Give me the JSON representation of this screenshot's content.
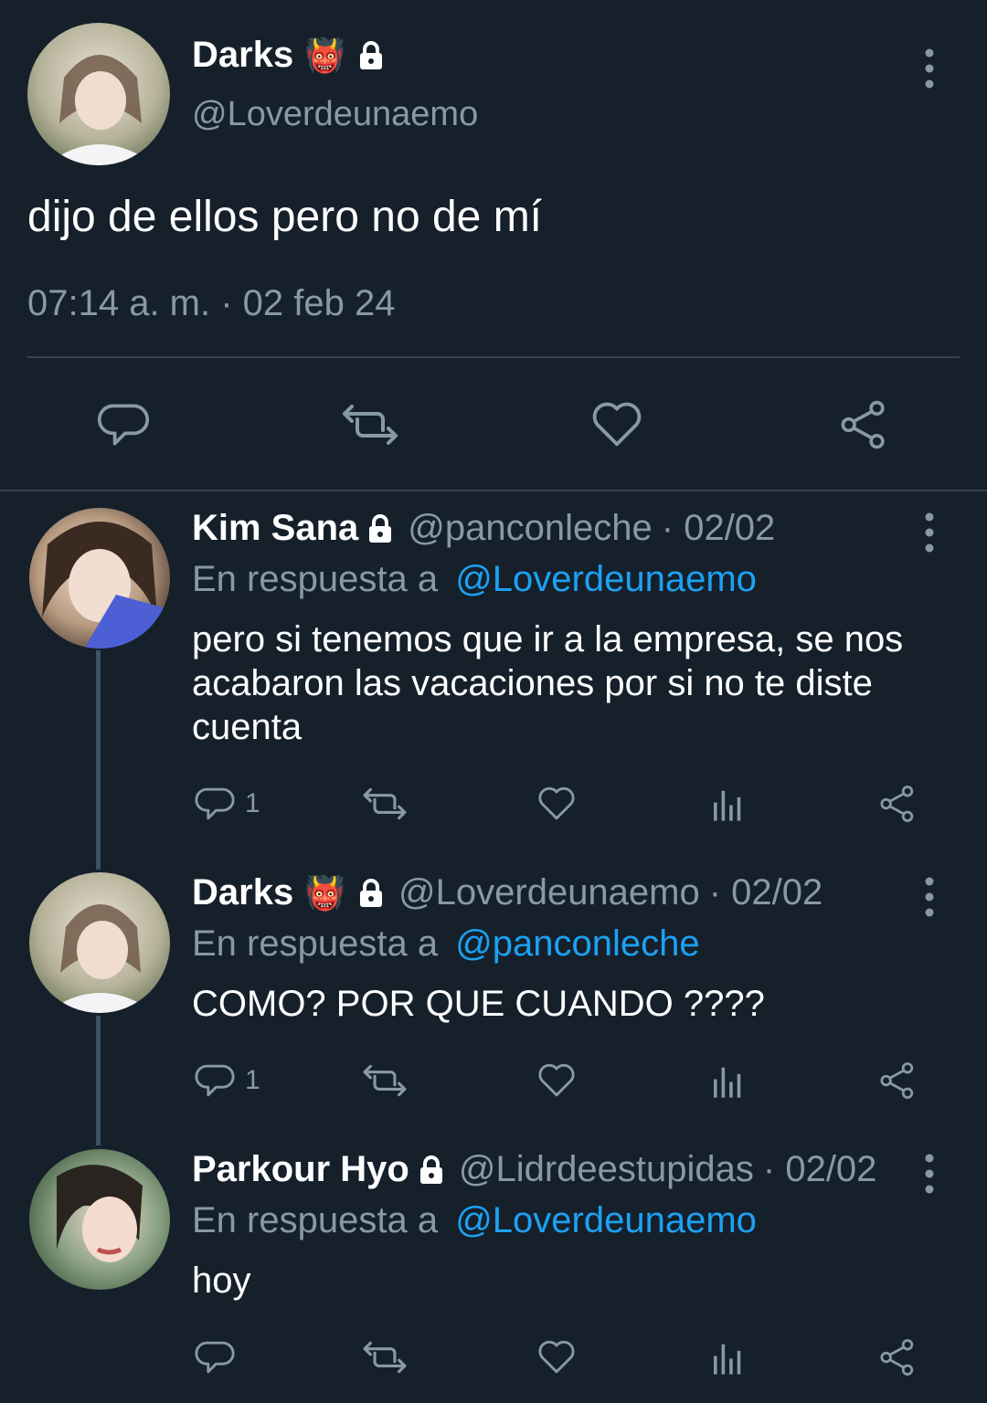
{
  "main_tweet": {
    "name": "Darks",
    "emoji": "👹",
    "handle": "@Loverdeunaemo",
    "text": "dijo de ellos pero no de mí",
    "timestamp": "07:14 a. m. · 02 feb 24",
    "icons": [
      "reply-icon",
      "retweet-icon",
      "like-icon",
      "share-icon"
    ]
  },
  "replies": [
    {
      "name": "Kim Sana",
      "handle": "@panconleche",
      "date": "· 02/02",
      "reply_prefix": "En respuesta a",
      "reply_to": "@Loverdeunaemo",
      "text": "pero si tenemos que ir a la empresa, se nos acabaron las vacaciones por si no te diste cuenta",
      "reply_count": "1"
    },
    {
      "name": "Darks",
      "emoji": "👹",
      "handle": "@Loverdeunaemo",
      "date": "· 02/02",
      "reply_prefix": "En respuesta a",
      "reply_to": "@panconleche",
      "text": "COMO? POR QUE CUANDO ????",
      "reply_count": "1"
    },
    {
      "name": "Parkour Hyo",
      "handle": "@Lidrdeestupidas",
      "date": "· 02/02",
      "reply_prefix": "En respuesta a",
      "reply_to": "@Loverdeunaemo",
      "text": "hoy",
      "reply_count": ""
    }
  ],
  "colors": {
    "background": "#15202b",
    "muted": "#8899a6",
    "link": "#1da1f2",
    "divider": "#38444d"
  }
}
